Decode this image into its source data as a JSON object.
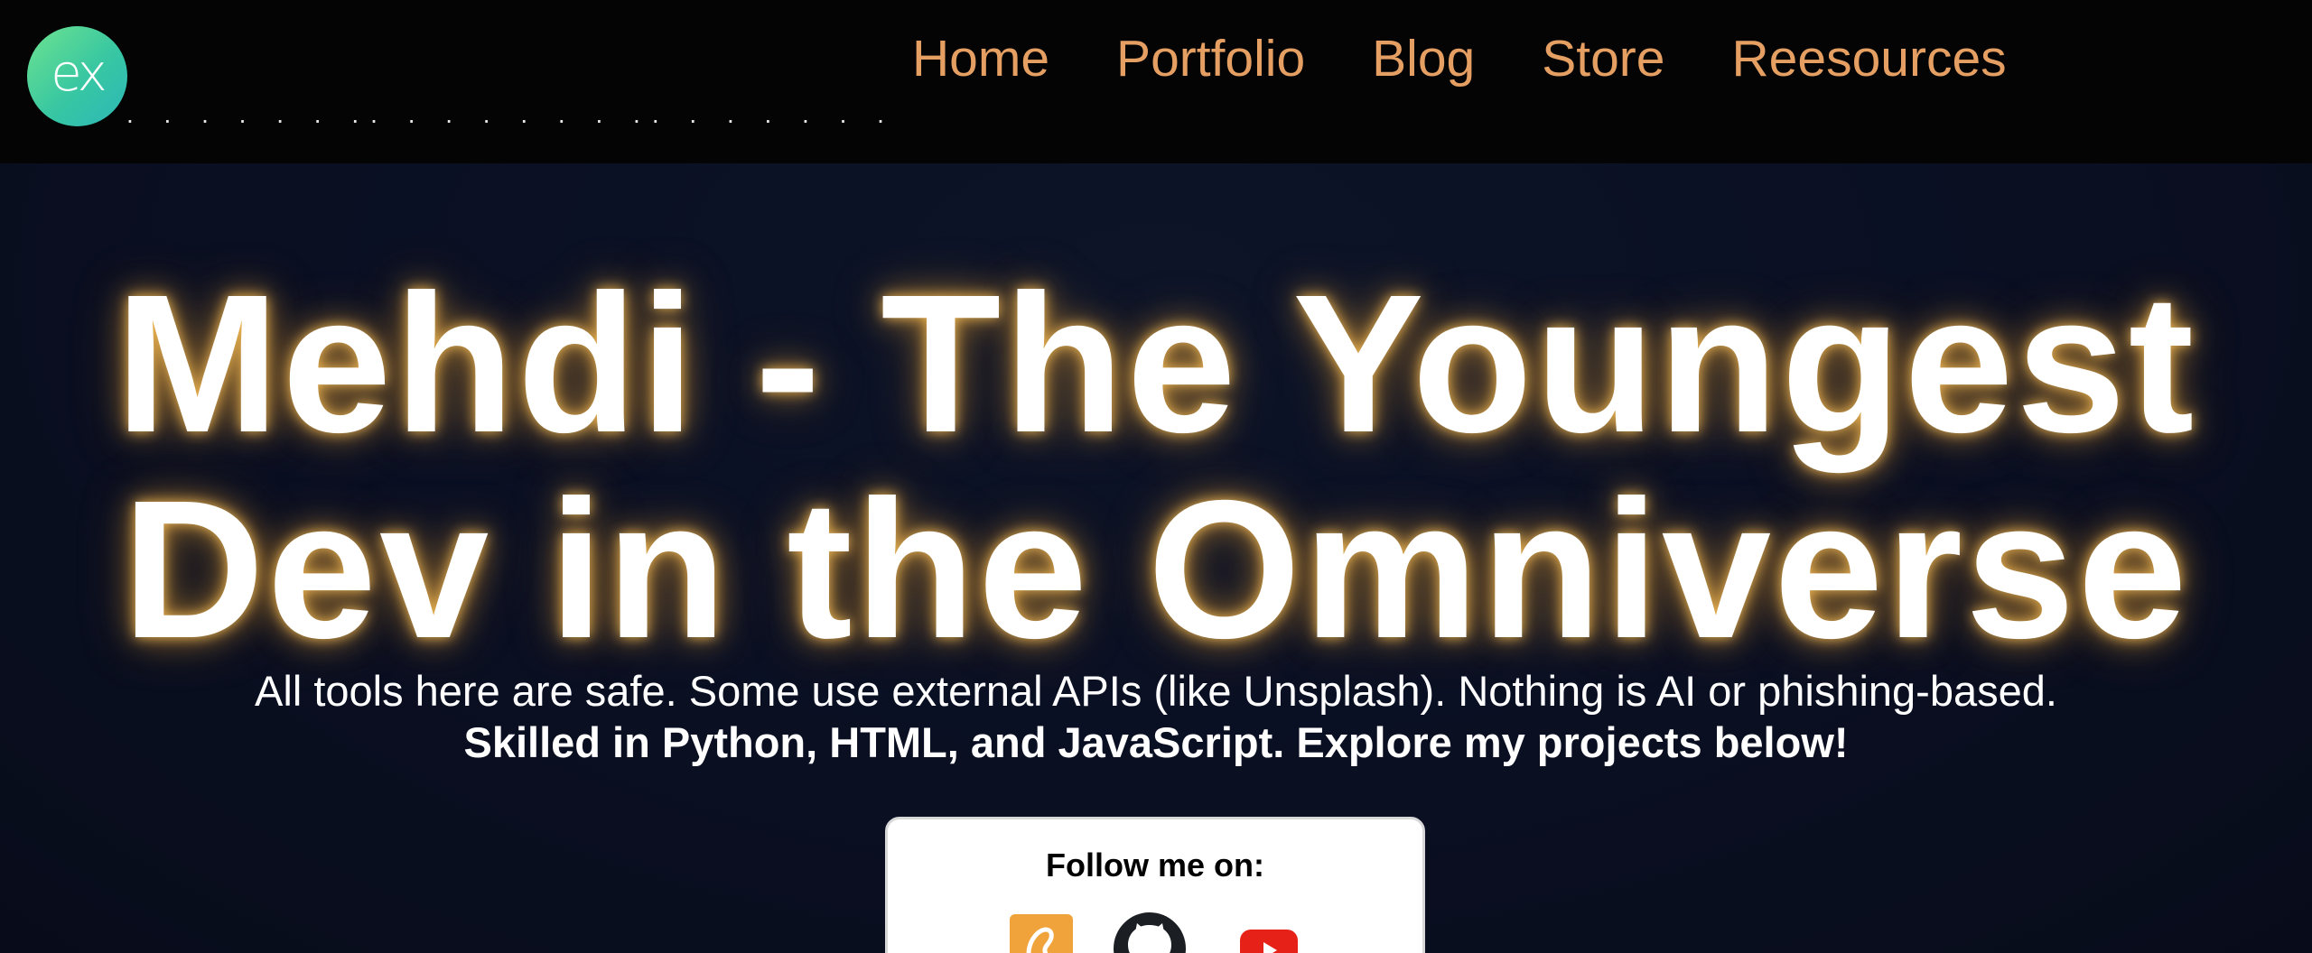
{
  "header": {
    "logo_text": "ex",
    "dots": ". . . . . . .. . . . . . . .. . . . . . . . . .. . . . . . . .. . . .",
    "nav": [
      {
        "label": "Home"
      },
      {
        "label": "Portfolio"
      },
      {
        "label": "Blog"
      },
      {
        "label": "Store"
      },
      {
        "label": "Reesources"
      }
    ]
  },
  "hero": {
    "title_line1": "Mehdi - The Youngest",
    "title_line2": "Dev in the Omniverse",
    "description": "All tools here are safe. Some use external APIs (like Unsplash). Nothing is AI or phishing-based.",
    "skills": "Skilled in Python, HTML, and JavaScript. Explore my projects below!"
  },
  "follow": {
    "title": "Follow me on:",
    "socials": [
      {
        "name": "scratch-icon",
        "color": "#f0a33a"
      },
      {
        "name": "github-icon",
        "color": "#1b1f23"
      },
      {
        "name": "youtube-icon",
        "color": "#e62117"
      }
    ]
  },
  "colors": {
    "background": "#0a0f1f",
    "header": "#040404",
    "nav_text": "#e59f62",
    "title_glow": "#f0aa3c",
    "logo_gradient_start": "#6ee38f",
    "logo_gradient_end": "#2db7b8"
  }
}
